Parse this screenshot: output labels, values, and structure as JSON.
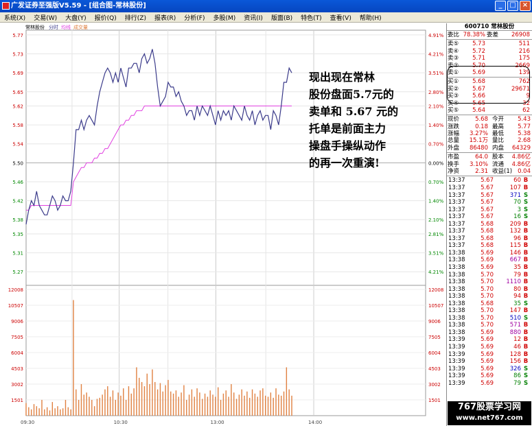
{
  "window": {
    "title": "广发证券至强版V5.59 - [组合图-常林股份]"
  },
  "menu": [
    "系统(X)",
    "交易(W)",
    "大盘(Y)",
    "报价(Q)",
    "排行(Z)",
    "报表(R)",
    "分析(F)",
    "多股(M)",
    "资讯(I)",
    "版面(B)",
    "特色(T)",
    "查看(V)",
    "帮助(H)"
  ],
  "chart": {
    "stock_label": "常林股份",
    "legend": {
      "fenshi": "分时",
      "junxian": "均线",
      "chengjiao": "成交量"
    },
    "price_ticks": [
      "5.77",
      "5.73",
      "5.69",
      "5.65",
      "5.62",
      "5.58",
      "5.54",
      "5.50",
      "5.46",
      "5.42",
      "5.38",
      "5.35",
      "5.31",
      "5.27"
    ],
    "pct_ticks": [
      "4.91%",
      "4.21%",
      "3.51%",
      "2.80%",
      "2.10%",
      "1.40%",
      "0.70%",
      "0.00%",
      "0.70%",
      "1.40%",
      "2.10%",
      "2.81%",
      "3.51%",
      "4.21%"
    ],
    "vol_ticks": [
      "12008",
      "10507",
      "9006",
      "7505",
      "6004",
      "4503",
      "3002",
      "1501"
    ],
    "time_ticks": [
      "09:30",
      "10:30",
      "13:00",
      "14:00"
    ]
  },
  "chart_data": {
    "type": "line",
    "ylim": [
      5.25,
      5.78
    ],
    "base_price": 5.5,
    "series": [
      {
        "name": "分时",
        "color": "#3a3a8a",
        "values": [
          5.37,
          5.4,
          5.42,
          5.41,
          5.44,
          5.41,
          5.4,
          5.39,
          5.39,
          5.41,
          5.43,
          5.42,
          5.4,
          5.41,
          5.43,
          5.42,
          5.42,
          5.44,
          5.5,
          5.57,
          5.57,
          5.59,
          5.57,
          5.59,
          5.6,
          5.59,
          5.58,
          5.62,
          5.65,
          5.67,
          5.69,
          5.7,
          5.69,
          5.67,
          5.69,
          5.67,
          5.7,
          5.68,
          5.66,
          5.7,
          5.7,
          5.71,
          5.71,
          5.69,
          5.72,
          5.73,
          5.71,
          5.72,
          5.74,
          5.71,
          5.66,
          5.62,
          5.63,
          5.64,
          5.67,
          5.66,
          5.66,
          5.64,
          5.65,
          5.63,
          5.62,
          5.6,
          5.61,
          5.61,
          5.59,
          5.62,
          5.6,
          5.62,
          5.61,
          5.6,
          5.62,
          5.6,
          5.58,
          5.61,
          5.59,
          5.61,
          5.6,
          5.61,
          5.59,
          5.62,
          5.61,
          5.6,
          5.59,
          5.62,
          5.6,
          5.59,
          5.61,
          5.58,
          5.6,
          5.61,
          5.59,
          5.6,
          5.6,
          5.57,
          5.61,
          5.6,
          5.58,
          5.62,
          5.67,
          5.67,
          5.7,
          5.69
        ]
      },
      {
        "name": "均线",
        "color": "#e040e0",
        "values": [
          5.4,
          5.4,
          5.41,
          5.41,
          5.41,
          5.41,
          5.41,
          5.41,
          5.41,
          5.41,
          5.41,
          5.41,
          5.41,
          5.41,
          5.41,
          5.41,
          5.41,
          5.41,
          5.46,
          5.47,
          5.48,
          5.49,
          5.49,
          5.5,
          5.5,
          5.5,
          5.51,
          5.51,
          5.52,
          5.52,
          5.53,
          5.53,
          5.54,
          5.55,
          5.56,
          5.57,
          5.58,
          5.58,
          5.59,
          5.59,
          5.6,
          5.6,
          5.61,
          5.61,
          5.61,
          5.62,
          5.62,
          5.62,
          5.62,
          5.62,
          5.62,
          5.62,
          5.62,
          5.62,
          5.62,
          5.62,
          5.62,
          5.62,
          5.62,
          5.62,
          5.62,
          5.62,
          5.62,
          5.62,
          5.62,
          5.62,
          5.62,
          5.62,
          5.62,
          5.62,
          5.62,
          5.62,
          5.62,
          5.62,
          5.62,
          5.62,
          5.62,
          5.62,
          5.62,
          5.62,
          5.62,
          5.62,
          5.62,
          5.62,
          5.62,
          5.62,
          5.62,
          5.62,
          5.62,
          5.62,
          5.62,
          5.62,
          5.62,
          5.62,
          5.62,
          5.62,
          5.62,
          5.62,
          5.62,
          5.62,
          5.62,
          5.62
        ]
      }
    ],
    "volume": [
      1200,
      800,
      600,
      1100,
      900,
      700,
      1500,
      600,
      800,
      500,
      1300,
      700,
      900,
      600,
      700,
      1500,
      800,
      600,
      11000,
      2500,
      1500,
      3000,
      2000,
      2200,
      1800,
      1500,
      900,
      1600,
      1700,
      2000,
      2500,
      2800,
      1800,
      2400,
      1500,
      2200,
      1900,
      2600,
      1500,
      2800,
      2100,
      2600,
      4600,
      3600,
      3200,
      2800,
      4000,
      3000,
      4400,
      3200,
      2500,
      3100,
      2300,
      2900,
      3400,
      2300,
      2100,
      2400,
      1800,
      2200,
      2900,
      1500,
      2000,
      2500,
      1800,
      2600,
      2200,
      1600,
      2100,
      1800,
      2400,
      2000,
      1800,
      2700,
      1500,
      2100,
      2400,
      1800,
      3000,
      2200,
      1600,
      2000,
      2500,
      1900,
      2300,
      1700,
      2500,
      2100,
      1800,
      2400,
      2600,
      1900,
      1800,
      2200,
      1700,
      2600,
      2000,
      1900,
      2300,
      4600,
      2500,
      1900
    ],
    "vol_ylim": [
      0,
      12008
    ]
  },
  "quote": {
    "code_name": "600710 常林股份",
    "wei": {
      "wb_label": "委比",
      "wb": "78.38%",
      "wc_label": "委差",
      "wc": "26908"
    },
    "sells": [
      {
        "label": "卖⑤",
        "price": "5.73",
        "vol": "511"
      },
      {
        "label": "卖④",
        "price": "5.72",
        "vol": "216"
      },
      {
        "label": "卖③",
        "price": "5.71",
        "vol": "175"
      },
      {
        "label": "卖②",
        "price": "5.70",
        "vol": "2669"
      },
      {
        "label": "卖①",
        "price": "5.69",
        "vol": "139"
      }
    ],
    "buys": [
      {
        "label": "买①",
        "price": "5.68",
        "vol": "762"
      },
      {
        "label": "买②",
        "price": "5.67",
        "vol": "29671"
      },
      {
        "label": "买③",
        "price": "5.66",
        "vol": "9"
      },
      {
        "label": "买④",
        "price": "5.65",
        "vol": "32"
      },
      {
        "label": "买⑤",
        "price": "5.64",
        "vol": "62"
      }
    ],
    "stats": [
      {
        "l1": "现价",
        "v1": "5.68",
        "l2": "今开",
        "v2": "5.43"
      },
      {
        "l1": "涨跌",
        "v1": "0.18",
        "l2": "最高",
        "v2": "5.77"
      },
      {
        "l1": "涨幅",
        "v1": "3.27%",
        "l2": "最低",
        "v2": "5.38"
      },
      {
        "l1": "总量",
        "v1": "15.1万",
        "l2": "量比",
        "v2": "2.68"
      },
      {
        "l1": "外盘",
        "v1": "86480",
        "l2": "内盘",
        "v2": "64329"
      }
    ],
    "fin": [
      {
        "l1": "市盈",
        "v1": "64.0",
        "l2": "股本",
        "v2": "4.86亿"
      },
      {
        "l1": "换手",
        "v1": "3.10%",
        "l2": "流通",
        "v2": "4.86亿"
      },
      {
        "l1": "净资",
        "v1": "2.31",
        "l2": "收益(1)",
        "v2": "0.04"
      }
    ],
    "ticks": [
      {
        "t": "13:37",
        "p": "5.67",
        "v": "60",
        "s": "B"
      },
      {
        "t": "13:37",
        "p": "5.67",
        "v": "107",
        "s": "B"
      },
      {
        "t": "13:37",
        "p": "5.67",
        "v": "371",
        "s": "S"
      },
      {
        "t": "13:37",
        "p": "5.67",
        "v": "70",
        "s": "S"
      },
      {
        "t": "13:37",
        "p": "5.67",
        "v": "3",
        "s": "S"
      },
      {
        "t": "13:37",
        "p": "5.67",
        "v": "16",
        "s": "S"
      },
      {
        "t": "13:37",
        "p": "5.68",
        "v": "209",
        "s": "B"
      },
      {
        "t": "13:37",
        "p": "5.68",
        "v": "132",
        "s": "B"
      },
      {
        "t": "13:37",
        "p": "5.68",
        "v": "96",
        "s": "B"
      },
      {
        "t": "13:37",
        "p": "5.68",
        "v": "115",
        "s": "B"
      },
      {
        "t": "13:38",
        "p": "5.69",
        "v": "146",
        "s": "B"
      },
      {
        "t": "13:38",
        "p": "5.69",
        "v": "667",
        "s": "B"
      },
      {
        "t": "13:38",
        "p": "5.69",
        "v": "35",
        "s": "B"
      },
      {
        "t": "13:38",
        "p": "5.70",
        "v": "79",
        "s": "B"
      },
      {
        "t": "13:38",
        "p": "5.70",
        "v": "1110",
        "s": "B"
      },
      {
        "t": "13:38",
        "p": "5.70",
        "v": "80",
        "s": "B"
      },
      {
        "t": "13:38",
        "p": "5.70",
        "v": "94",
        "s": "B"
      },
      {
        "t": "13:38",
        "p": "5.68",
        "v": "35",
        "s": "S"
      },
      {
        "t": "13:38",
        "p": "5.70",
        "v": "147",
        "s": "B"
      },
      {
        "t": "13:38",
        "p": "5.70",
        "v": "510",
        "s": "S"
      },
      {
        "t": "13:38",
        "p": "5.70",
        "v": "571",
        "s": "B"
      },
      {
        "t": "13:38",
        "p": "5.69",
        "v": "880",
        "s": "B"
      },
      {
        "t": "13:39",
        "p": "5.69",
        "v": "12",
        "s": "B"
      },
      {
        "t": "13:39",
        "p": "5.69",
        "v": "46",
        "s": "B"
      },
      {
        "t": "13:39",
        "p": "5.69",
        "v": "128",
        "s": "B"
      },
      {
        "t": "13:39",
        "p": "5.69",
        "v": "156",
        "s": "B"
      },
      {
        "t": "13:39",
        "p": "5.69",
        "v": "326",
        "s": "S"
      },
      {
        "t": "13:39",
        "p": "5.69",
        "v": "86",
        "s": "S"
      },
      {
        "t": "13:39",
        "p": "5.69",
        "v": "79",
        "s": "S"
      }
    ]
  },
  "annotation": [
    "现出现在常林",
    "股份盘面5.7元的",
    "卖单和 5.67 元的",
    "托单是前面主力",
    "操盘手操纵动作",
    "的再一次重演!"
  ],
  "watermark": {
    "line1": "767股票学习网",
    "line2": "www.net767.com"
  },
  "colors": {
    "price_line": "#3a3a8a",
    "avg_line": "#e040e0",
    "volume": "#e08040",
    "up": "#d00000",
    "down": "#008000"
  }
}
